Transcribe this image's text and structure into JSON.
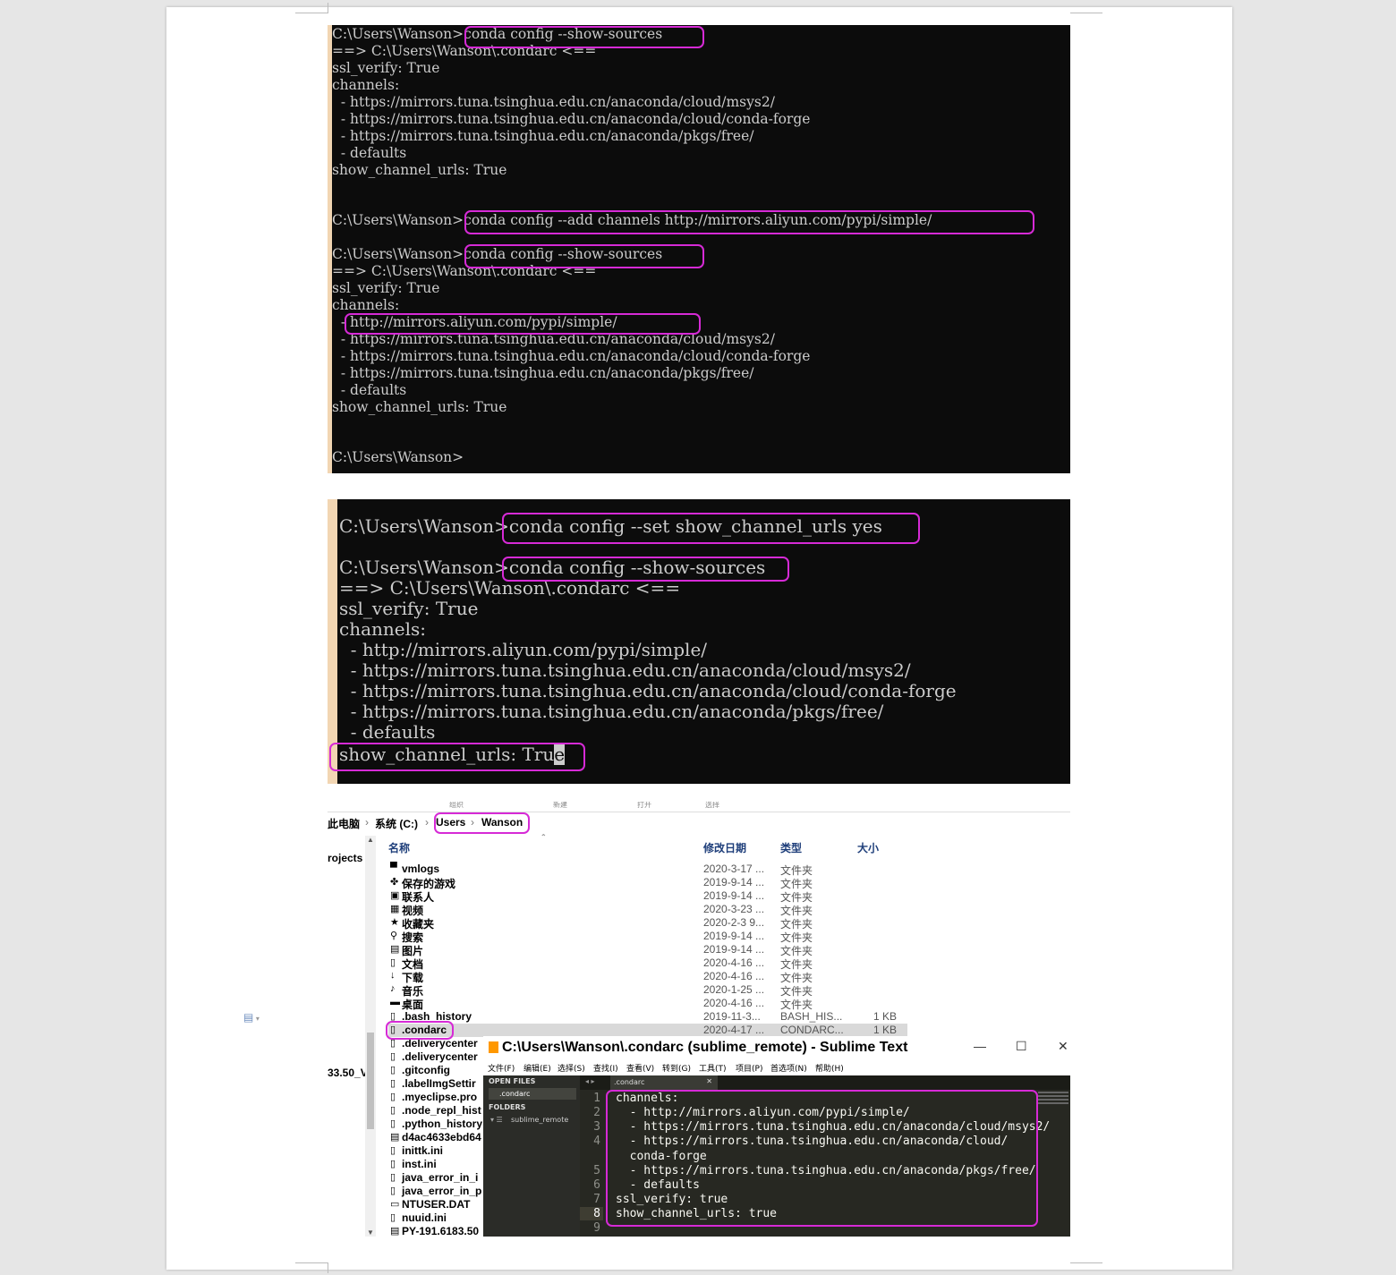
{
  "terminal1": {
    "lines": [
      "C:\\Users\\Wanson>conda config --show-sources",
      "==> C:\\Users\\Wanson\\.condarc <==",
      "ssl_verify: True",
      "channels:",
      "  - https://mirrors.tuna.tsinghua.edu.cn/anaconda/cloud/msys2/",
      "  - https://mirrors.tuna.tsinghua.edu.cn/anaconda/cloud/conda-forge",
      "  - https://mirrors.tuna.tsinghua.edu.cn/anaconda/pkgs/free/",
      "  - defaults",
      "show_channel_urls: True",
      "C:\\Users\\Wanson>conda config --add channels http://mirrors.aliyun.com/pypi/simple/",
      "C:\\Users\\Wanson>conda config --show-sources",
      "==> C:\\Users\\Wanson\\.condarc <==",
      "ssl_verify: True",
      "channels:",
      "  - http://mirrors.aliyun.com/pypi/simple/",
      "  - https://mirrors.tuna.tsinghua.edu.cn/anaconda/cloud/msys2/",
      "  - https://mirrors.tuna.tsinghua.edu.cn/anaconda/cloud/conda-forge",
      "  - https://mirrors.tuna.tsinghua.edu.cn/anaconda/pkgs/free/",
      "  - defaults",
      "show_channel_urls: True",
      "C:\\Users\\Wanson>"
    ]
  },
  "terminal2": {
    "lines": [
      "C:\\Users\\Wanson>conda config --set show_channel_urls yes",
      "C:\\Users\\Wanson>conda config --show-sources",
      "==> C:\\Users\\Wanson\\.condarc <==",
      "ssl_verify: True",
      "channels:",
      "  - http://mirrors.aliyun.com/pypi/simple/",
      "  - https://mirrors.tuna.tsinghua.edu.cn/anaconda/cloud/msys2/",
      "  - https://mirrors.tuna.tsinghua.edu.cn/anaconda/cloud/conda-forge",
      "  - https://mirrors.tuna.tsinghua.edu.cn/anaconda/pkgs/free/",
      "  - defaults"
    ],
    "last_line_main": "show_channel_urls: Tru",
    "last_line_cursor": "e"
  },
  "explorer": {
    "ribbon": [
      "组织",
      "新建",
      "打开",
      "选择"
    ],
    "breadcrumb": [
      "此电脑",
      "›",
      "系统 (C:)",
      "›",
      "Users",
      "›",
      "Wanson"
    ],
    "nav_items": [
      "rojects",
      "33.50_V"
    ],
    "columns": {
      "name": "名称",
      "date": "修改日期",
      "type": "类型",
      "size": "大小"
    },
    "rows": [
      {
        "icon": "folder-icon",
        "glyph": "▀",
        "name": "vmlogs",
        "date": "2020-3-17 ...",
        "type": "文件夹",
        "size": ""
      },
      {
        "icon": "saved-games-icon",
        "glyph": "✤",
        "name": "保存的游戏",
        "date": "2019-9-14 ...",
        "type": "文件夹",
        "size": ""
      },
      {
        "icon": "contacts-icon",
        "glyph": "▣",
        "name": "联系人",
        "date": "2019-9-14 ...",
        "type": "文件夹",
        "size": ""
      },
      {
        "icon": "videos-icon",
        "glyph": "▦",
        "name": "视频",
        "date": "2020-3-23 ...",
        "type": "文件夹",
        "size": ""
      },
      {
        "icon": "favorites-icon",
        "glyph": "★",
        "name": "收藏夹",
        "date": "2020-2-3 9...",
        "type": "文件夹",
        "size": ""
      },
      {
        "icon": "search-icon",
        "glyph": "⚲",
        "name": "搜索",
        "date": "2019-9-14 ...",
        "type": "文件夹",
        "size": ""
      },
      {
        "icon": "pictures-icon",
        "glyph": "▤",
        "name": "图片",
        "date": "2019-9-14 ...",
        "type": "文件夹",
        "size": ""
      },
      {
        "icon": "documents-icon",
        "glyph": "▯",
        "name": "文档",
        "date": "2020-4-16 ...",
        "type": "文件夹",
        "size": ""
      },
      {
        "icon": "downloads-icon",
        "glyph": "↓",
        "name": "下载",
        "date": "2020-4-16 ...",
        "type": "文件夹",
        "size": ""
      },
      {
        "icon": "music-icon",
        "glyph": "♪",
        "name": "音乐",
        "date": "2020-1-25 ...",
        "type": "文件夹",
        "size": ""
      },
      {
        "icon": "desktop-icon",
        "glyph": "▬",
        "name": "桌面",
        "date": "2020-4-16 ...",
        "type": "文件夹",
        "size": ""
      },
      {
        "icon": "file-icon",
        "glyph": "▯",
        "name": ".bash_history",
        "date": "2019-11-3...",
        "type": "BASH_HIS...",
        "size": "1 KB"
      },
      {
        "icon": "file-icon",
        "glyph": "▯",
        "name": ".condarc",
        "date": "2020-4-17 ...",
        "type": "CONDARC...",
        "size": "1 KB"
      },
      {
        "icon": "file-icon",
        "glyph": "▯",
        "name": ".deliverycenter",
        "date": "",
        "type": "",
        "size": ""
      },
      {
        "icon": "file-icon",
        "glyph": "▯",
        "name": ".deliverycenter",
        "date": "",
        "type": "",
        "size": ""
      },
      {
        "icon": "file-icon",
        "glyph": "▯",
        "name": ".gitconfig",
        "date": "",
        "type": "",
        "size": ""
      },
      {
        "icon": "file-icon",
        "glyph": "▯",
        "name": ".labelImgSettir",
        "date": "",
        "type": "",
        "size": ""
      },
      {
        "icon": "file-icon",
        "glyph": "▯",
        "name": ".myeclipse.pro",
        "date": "",
        "type": "",
        "size": ""
      },
      {
        "icon": "file-icon",
        "glyph": "▯",
        "name": ".node_repl_hist",
        "date": "",
        "type": "",
        "size": ""
      },
      {
        "icon": "file-icon",
        "glyph": "▯",
        "name": ".python_history",
        "date": "",
        "type": "",
        "size": ""
      },
      {
        "icon": "archive-icon",
        "glyph": "▤",
        "name": "d4ac4633ebd64",
        "date": "",
        "type": "",
        "size": ""
      },
      {
        "icon": "ini-file-icon",
        "glyph": "▯",
        "name": "inittk.ini",
        "date": "",
        "type": "",
        "size": ""
      },
      {
        "icon": "ini-file-icon",
        "glyph": "▯",
        "name": "inst.ini",
        "date": "",
        "type": "",
        "size": ""
      },
      {
        "icon": "file-icon",
        "glyph": "▯",
        "name": "java_error_in_i",
        "date": "",
        "type": "",
        "size": ""
      },
      {
        "icon": "file-icon",
        "glyph": "▯",
        "name": "java_error_in_p",
        "date": "",
        "type": "",
        "size": ""
      },
      {
        "icon": "dat-file-icon",
        "glyph": "▭",
        "name": "NTUSER.DAT",
        "date": "",
        "type": "",
        "size": ""
      },
      {
        "icon": "ini-file-icon",
        "glyph": "▯",
        "name": "nuuid.ini",
        "date": "",
        "type": "",
        "size": ""
      },
      {
        "icon": "archive-icon",
        "glyph": "▤",
        "name": "PY-191.6183.50",
        "date": "",
        "type": "",
        "size": ""
      }
    ]
  },
  "sublime": {
    "title": "C:\\Users\\Wanson\\.condarc (sublime_remote) - Sublime Text",
    "window_buttons": [
      "—",
      "☐",
      "✕"
    ],
    "menu": [
      "文件(F)",
      "编辑(E)",
      "选择(S)",
      "查找(I)",
      "查看(V)",
      "转到(G)",
      "工具(T)",
      "项目(P)",
      "首选项(N)",
      "帮助(H)"
    ],
    "sidebar": {
      "open_files_label": "OPEN FILES",
      "open_file": ".condarc",
      "folders_label": "FOLDERS",
      "folder": "sublime_remote"
    },
    "tab": {
      "label": ".condarc",
      "close": "✕",
      "arrows": "◂ ▸"
    },
    "gutter": [
      "1",
      "2",
      "3",
      "4",
      "",
      "5",
      "6",
      "7",
      "8",
      "9"
    ],
    "code": [
      "channels:",
      "  - http://mirrors.aliyun.com/pypi/simple/",
      "  - https://mirrors.tuna.tsinghua.edu.cn/anaconda/cloud/msys2/",
      "  - https://mirrors.tuna.tsinghua.edu.cn/anaconda/cloud/",
      "  conda-forge",
      "  - https://mirrors.tuna.tsinghua.edu.cn/anaconda/pkgs/free/",
      "  - defaults",
      "ssl_verify: true",
      "show_channel_urls: true",
      ""
    ]
  },
  "colors": {
    "highlight": "#d62ad6",
    "terminal_bg": "#0c0c0c",
    "terminal_fg": "#cccccc",
    "sublime_bg": "#272822"
  }
}
